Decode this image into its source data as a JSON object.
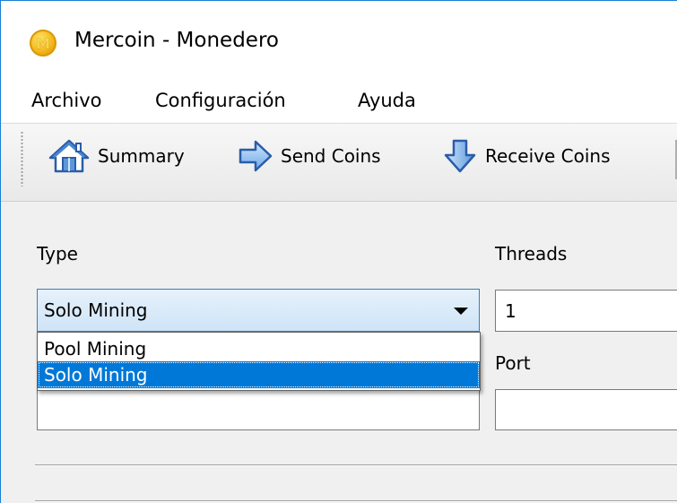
{
  "window": {
    "title": "Mercoin - Monedero",
    "icon": "mercoin-logo-icon",
    "icon_letter": "M"
  },
  "menu": {
    "items": [
      "Archivo",
      "Configuración",
      "Ayuda"
    ]
  },
  "toolbar": {
    "buttons": [
      {
        "label": "Summary",
        "icon": "home-icon"
      },
      {
        "label": "Send Coins",
        "icon": "arrow-right-icon"
      },
      {
        "label": "Receive Coins",
        "icon": "arrow-down-icon"
      }
    ]
  },
  "form": {
    "type_label": "Type",
    "threads_label": "Threads",
    "port_label": "Port",
    "type_selected": "Solo Mining",
    "type_options": [
      "Pool Mining",
      "Solo Mining"
    ],
    "type_highlighted": "Solo Mining",
    "threads_value": "1",
    "host_value": "",
    "port_value": ""
  },
  "colors": {
    "accent": "#0078d7",
    "window_border": "#1a7fd4",
    "combo_border": "#3c7fb1"
  }
}
